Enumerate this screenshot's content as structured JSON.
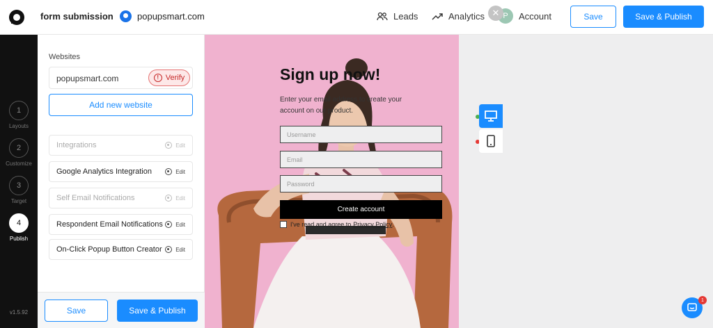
{
  "header": {
    "form_title": "form submission",
    "site_name": "popupsmart.com",
    "nav": [
      {
        "label": "Leads",
        "icon": "users-icon"
      },
      {
        "label": "Analytics",
        "icon": "trend-chart-icon"
      },
      {
        "label": "Account",
        "icon": "avatar"
      }
    ],
    "avatar_letter": "P",
    "save_label": "Save",
    "publish_label": "Save & Publish"
  },
  "steps": [
    {
      "number": "1",
      "label": "Layouts",
      "active": false
    },
    {
      "number": "2",
      "label": "Customize",
      "active": false
    },
    {
      "number": "3",
      "label": "Target",
      "active": false
    },
    {
      "number": "4",
      "label": "Publish",
      "active": true
    }
  ],
  "version": "v1.5.92",
  "panel": {
    "websites_heading": "Websites",
    "domain": "popupsmart.com",
    "verify_label": "Verify",
    "add_website_label": "Add new website",
    "integrations": [
      {
        "label": "Integrations",
        "edit": "Edit",
        "muted": true
      },
      {
        "label": "Google Analytics Integration",
        "edit": "Edit",
        "muted": false
      },
      {
        "label": "Self Email Notifications",
        "edit": "Edit",
        "muted": true
      },
      {
        "label": "Respondent Email Notifications",
        "edit": "Edit",
        "muted": false
      },
      {
        "label": "On-Click Popup Button Creator",
        "edit": "Edit",
        "muted": false
      }
    ],
    "save_label": "Save",
    "publish_label": "Save & Publish"
  },
  "popup": {
    "title": "Sign up now!",
    "description": "Enter your email address to create your account on our product.",
    "username_placeholder": "Username",
    "email_placeholder": "Email",
    "password_placeholder": "Password",
    "create_label": "Create account",
    "agree_text": "I've read and agree to",
    "privacy_link": "Privacy Policy",
    "agree_end": "."
  },
  "chat_badge": "1",
  "colors": {
    "accent": "#1a8cff",
    "rail": "#111111",
    "photo_bg": "#f0b2cf",
    "verify_red": "#c62828"
  }
}
